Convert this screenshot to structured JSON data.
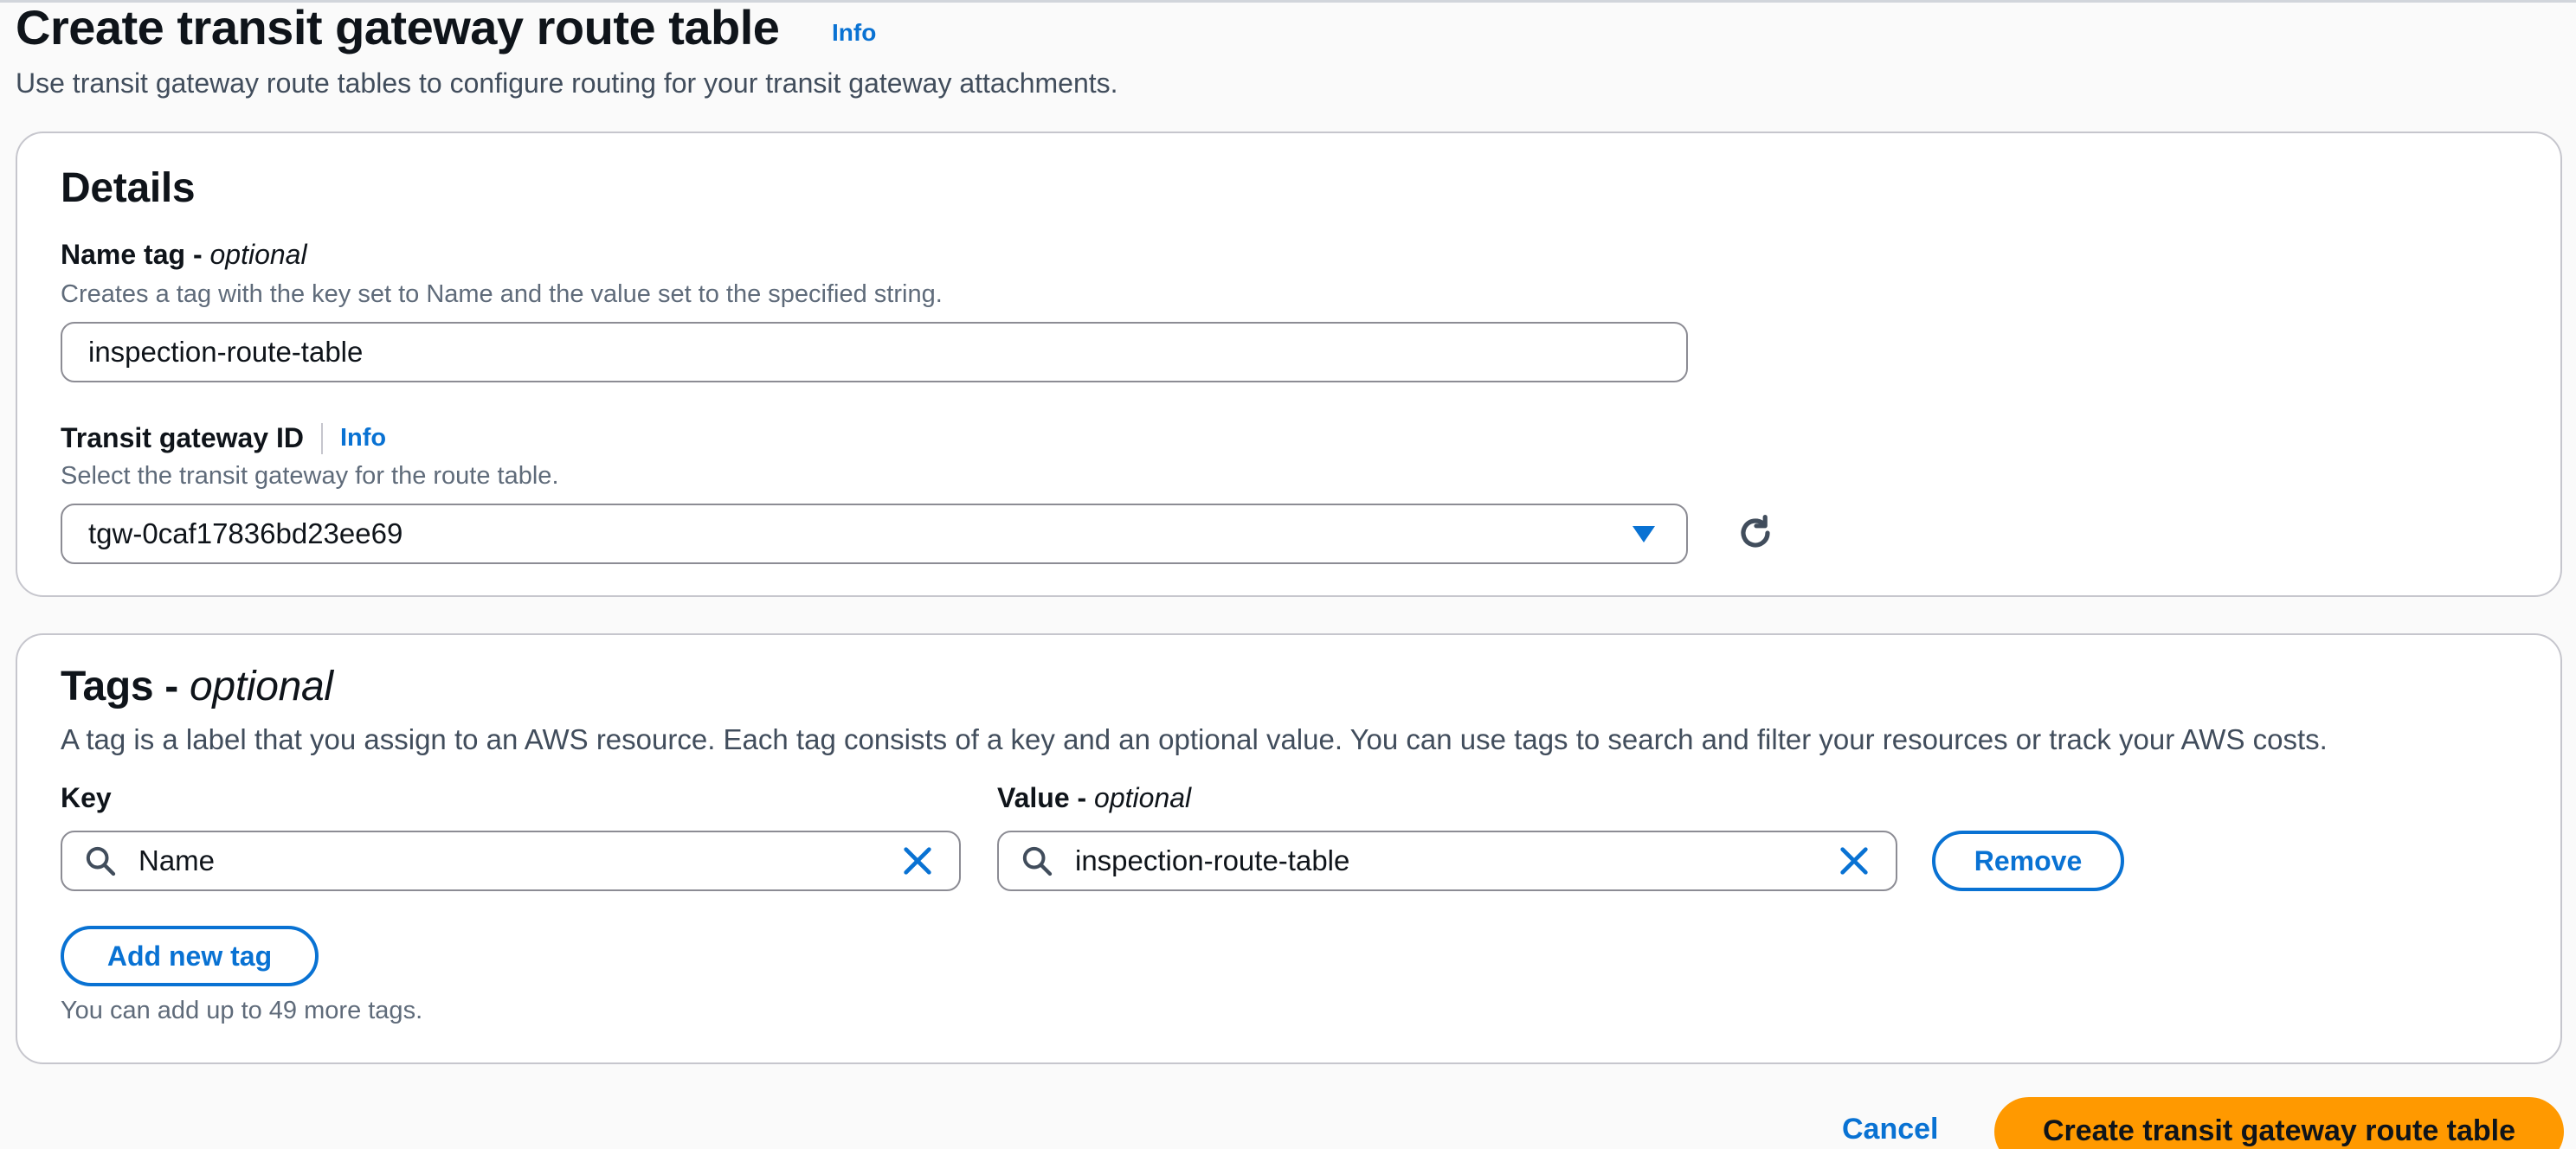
{
  "header": {
    "title": "Create transit gateway route table",
    "info_label": "Info",
    "description": "Use transit gateway route tables to configure routing for your transit gateway attachments."
  },
  "details": {
    "heading": "Details",
    "name_tag": {
      "label": "Name tag - ",
      "label_optional": "optional",
      "description": "Creates a tag with the key set to Name and the value set to the specified string.",
      "value": "inspection-route-table"
    },
    "transit_gateway": {
      "label": "Transit gateway ID",
      "info_label": "Info",
      "description": "Select the transit gateway for the route table.",
      "selected": "tgw-0caf17836bd23ee69"
    }
  },
  "tags": {
    "heading": "Tags - ",
    "heading_optional": "optional",
    "description": "A tag is a label that you assign to an AWS resource. Each tag consists of a key and an optional value. You can use tags to search and filter your resources or track your AWS costs.",
    "key_label": "Key",
    "value_label": "Value - ",
    "value_label_optional": "optional",
    "rows": [
      {
        "key": "Name",
        "value": "inspection-route-table",
        "remove_label": "Remove"
      }
    ],
    "add_label": "Add new tag",
    "limit_text": "You can add up to 49 more tags."
  },
  "footer": {
    "cancel_label": "Cancel",
    "submit_label": "Create transit gateway route table"
  },
  "colors": {
    "link": "#0972d3",
    "primary_button": "#ff9900",
    "border": "#8c8c94"
  },
  "icons": [
    "info-icon",
    "caret-down-icon",
    "refresh-icon",
    "search-icon",
    "close-icon"
  ]
}
